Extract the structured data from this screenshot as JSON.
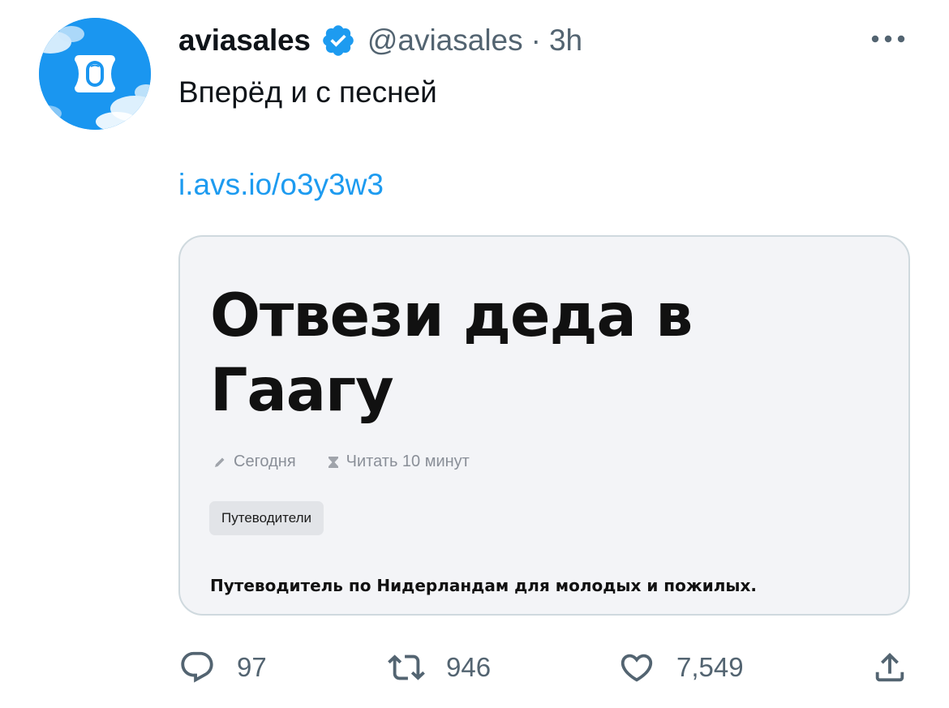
{
  "author": {
    "display_name": "aviasales",
    "handle": "@aviasales",
    "separator": "·",
    "time": "3h",
    "verified": true,
    "avatar_icon": "airplane-window-icon"
  },
  "tweet": {
    "text": "Вперёд и с песней",
    "link": "i.avs.io/o3y3w3"
  },
  "card": {
    "title": "Отвези деда в Гаагу",
    "meta": {
      "date": "Сегодня",
      "read_time": "Читать 10 минут"
    },
    "tag": "Путеводители",
    "description": "Путеводитель по Нидерландам для молодых и пожилых."
  },
  "actions": {
    "replies": "97",
    "retweets": "946",
    "likes": "7,549"
  },
  "colors": {
    "accent": "#1d9bf0",
    "avatar_bg": "#1a96f0",
    "muted": "#536471",
    "card_bg": "#f3f4f7",
    "card_border": "#cfd9de"
  }
}
